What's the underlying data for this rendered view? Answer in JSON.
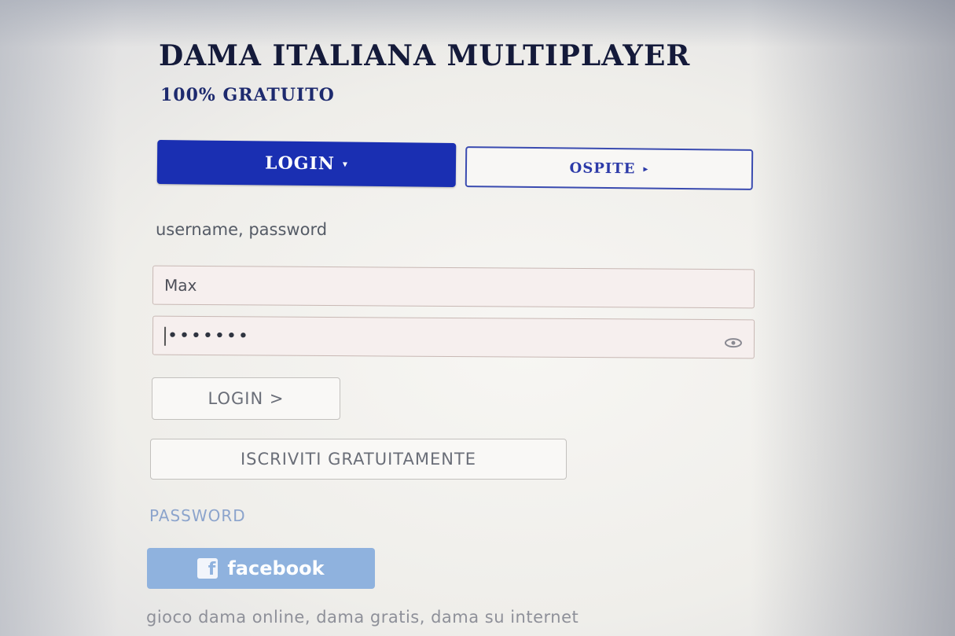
{
  "header": {
    "title": "DAMA ITALIANA MULTIPLAYER",
    "subtitle": "100% GRATUITO"
  },
  "tabs": {
    "login_label": "LOGIN",
    "login_caret": "▾",
    "guest_label": "OSPITE",
    "guest_caret": "▸"
  },
  "form": {
    "hint": "username, password",
    "username_value": "Max",
    "password_mask": "•••••••",
    "login_button": "LOGIN >",
    "register_button": "ISCRIVITI GRATUITAMENTE",
    "password_link": "PASSWORD"
  },
  "social": {
    "facebook_label": "facebook",
    "facebook_icon_glyph": "f"
  },
  "footer": {
    "keywords": "gioco dama online, dama gratis, dama su internet"
  },
  "colors": {
    "primary": "#1a2fb2",
    "outline": "#3a4bb0",
    "facebook": "#8fb2de",
    "link": "#8ca4cc"
  },
  "icons": {
    "password_toggle": "eye-icon",
    "facebook": "facebook-icon"
  }
}
